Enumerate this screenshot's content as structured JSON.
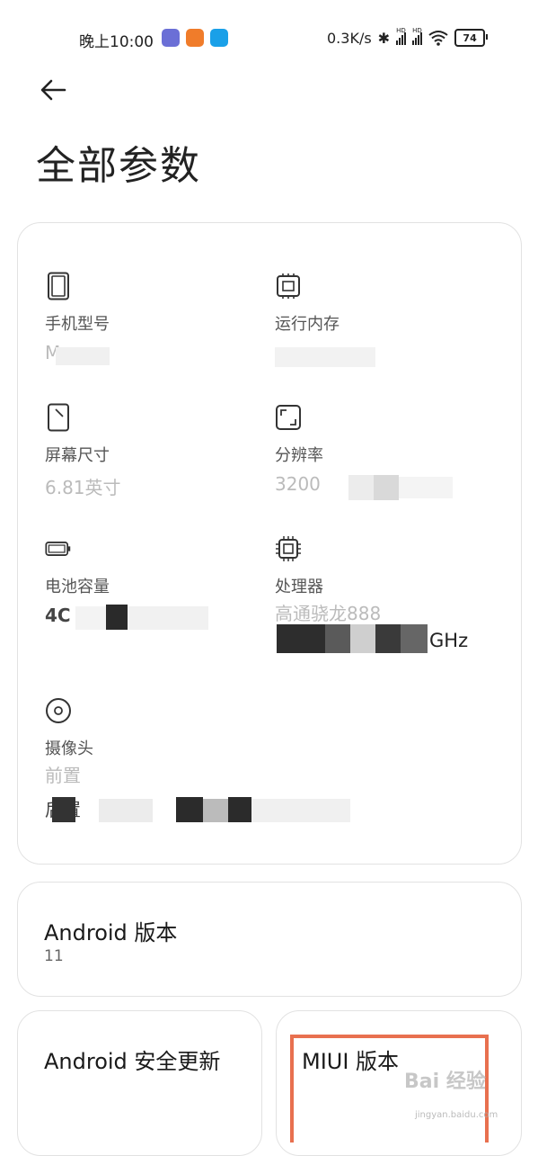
{
  "status": {
    "time": "晚上10:00",
    "speed": "0.3K/s",
    "battery": "74",
    "app_icons": [
      {
        "name": "app-icon-purple",
        "color": "#6b6fd6"
      },
      {
        "name": "app-icon-orange",
        "color": "#f07c2a"
      },
      {
        "name": "app-icon-blue",
        "color": "#1aa0e8"
      }
    ]
  },
  "header": {
    "title": "全部参数"
  },
  "specs": {
    "model": {
      "label": "手机型号",
      "value": "M"
    },
    "ram": {
      "label": "运行内存",
      "value": ""
    },
    "screen": {
      "label": "屏幕尺寸",
      "value": "6.81英寸"
    },
    "resolution": {
      "label": "分辨率",
      "value": "3200"
    },
    "battery": {
      "label": "电池容量",
      "value": "4C"
    },
    "cpu": {
      "label": "处理器",
      "value": "高通骁龙888",
      "value2": "GHz"
    },
    "camera": {
      "label": "摄像头",
      "value": "前置",
      "value2": "后置"
    }
  },
  "android": {
    "title": "Android 版本",
    "value": "11"
  },
  "security": {
    "title": "Android 安全更新"
  },
  "miui": {
    "title": "MIUI 版本"
  },
  "watermark": {
    "text": "Bai 经验",
    "url": "jingyan.baidu.com"
  },
  "colors": {
    "highlight": "#e8704f"
  }
}
